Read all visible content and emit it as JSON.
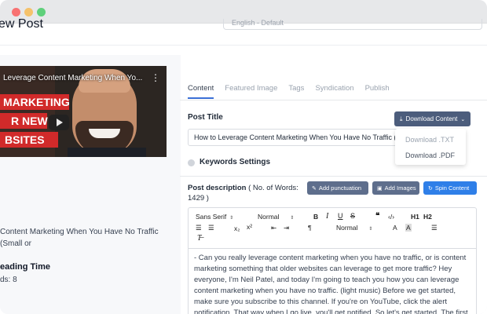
{
  "header": {
    "page_title": "ew Post",
    "language_select_value": "English - Default"
  },
  "video": {
    "title": "Leverage Content Marketing When Yo...",
    "banner_lines": [
      "MARKETING",
      "R NEW",
      "BSITES"
    ]
  },
  "left_panel": {
    "post_title_preview": "Content Marketing When You Have No Traffic (Small or",
    "reading_time_label": "eading Time",
    "words_label": "ds: 8"
  },
  "tabs": [
    {
      "label": "Content",
      "active": true
    },
    {
      "label": "Featured Image",
      "active": false
    },
    {
      "label": "Tags",
      "active": false
    },
    {
      "label": "Syndication",
      "active": false
    },
    {
      "label": "Publish",
      "active": false
    }
  ],
  "post_title": {
    "label": "Post Title",
    "value": "How to Leverage Content Marketing When You Have No Traffic (Sm"
  },
  "download": {
    "button_label": "Download Content",
    "options": [
      "Download .TXT",
      "Download .PDF"
    ]
  },
  "keywords_settings_label": "Keywords Settings",
  "post_description": {
    "label": "Post description",
    "words_note": "( No. of Words: 1429 )"
  },
  "action_buttons": {
    "add_punctuation": "Add punctuation",
    "add_images": "Add Images",
    "spin_content": "Spin Content"
  },
  "editor_toolbar": {
    "font_select": "Sans Serif",
    "size_select": "Normal",
    "align_select": "Normal",
    "header_1": "H1",
    "header_2": "H2"
  },
  "editor_content": "- Can you really leverage content marketing when you have no traffic, or is content marketing something that older websites can leverage to get more traffic? Hey everyone, I'm Neil Patel, and today I'm going to teach you how you can leverage content marketing when you have no traffic. (light music) Before we get started, make sure you subscribe to this channel. If you're on YouTube, click the alert notification. That way when I go live, you'll get notified. So let's get started. The first tip I have for you is to leverage",
  "colors": {
    "accent_blue": "#2f7fe8",
    "button_slate": "#5e6e8c",
    "download_button": "#4c5d7c",
    "banner_red": "#d12a2a",
    "tab_active_underline": "#3b6fd6"
  },
  "icons": {
    "download": "download-icon",
    "punctuation": "edit-icon",
    "images": "image-icon",
    "spin": "refresh-icon"
  }
}
